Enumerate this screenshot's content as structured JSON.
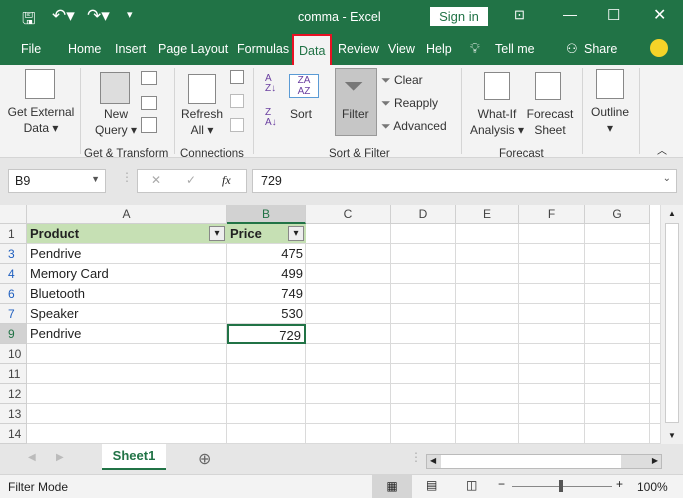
{
  "title_bar": {
    "title": "comma  -  Excel",
    "sign_in": "Sign in"
  },
  "menu_tabs": [
    "File",
    "Home",
    "Insert",
    "Page Layout",
    "Formulas",
    "Data",
    "Review",
    "View",
    "Help"
  ],
  "active_tab": "Data",
  "tell_me": "Tell me",
  "share": "Share",
  "ribbon": {
    "get_external_data": "Get External Data",
    "new_query": "New Query",
    "refresh_all": "Refresh All",
    "sort": "Sort",
    "filter": "Filter",
    "clear": "Clear",
    "reapply": "Reapply",
    "advanced": "Advanced",
    "what_if": "What-If Analysis",
    "forecast_sheet": "Forecast Sheet",
    "outline": "Outline",
    "groups": {
      "get_transform": "Get & Transform",
      "connections": "Connections",
      "sort_filter": "Sort & Filter",
      "forecast": "Forecast"
    }
  },
  "formula_bar": {
    "name_box": "B9",
    "fx": "fx",
    "value": "729"
  },
  "columns": [
    "A",
    "B",
    "C",
    "D",
    "E",
    "F",
    "G"
  ],
  "rows": [
    {
      "num": "1",
      "a": "Product",
      "b": "Price",
      "header": true
    },
    {
      "num": "3",
      "a": "Pendrive",
      "b": "475"
    },
    {
      "num": "4",
      "a": "Memory Card",
      "b": "499"
    },
    {
      "num": "6",
      "a": "Bluetooth",
      "b": "749"
    },
    {
      "num": "7",
      "a": "Speaker",
      "b": "530"
    },
    {
      "num": "9",
      "a": "Pendrive",
      "b": "729"
    },
    {
      "num": "10",
      "a": "",
      "b": ""
    },
    {
      "num": "11",
      "a": "",
      "b": ""
    },
    {
      "num": "12",
      "a": "",
      "b": ""
    },
    {
      "num": "13",
      "a": "",
      "b": ""
    },
    {
      "num": "14",
      "a": "",
      "b": ""
    }
  ],
  "sheet_tabs": [
    "Sheet1"
  ],
  "status": {
    "mode": "Filter Mode",
    "zoom": "100%"
  },
  "colors": {
    "brand": "#217346",
    "header_fill": "#c6e0b4",
    "active_highlight": "#e81123"
  }
}
